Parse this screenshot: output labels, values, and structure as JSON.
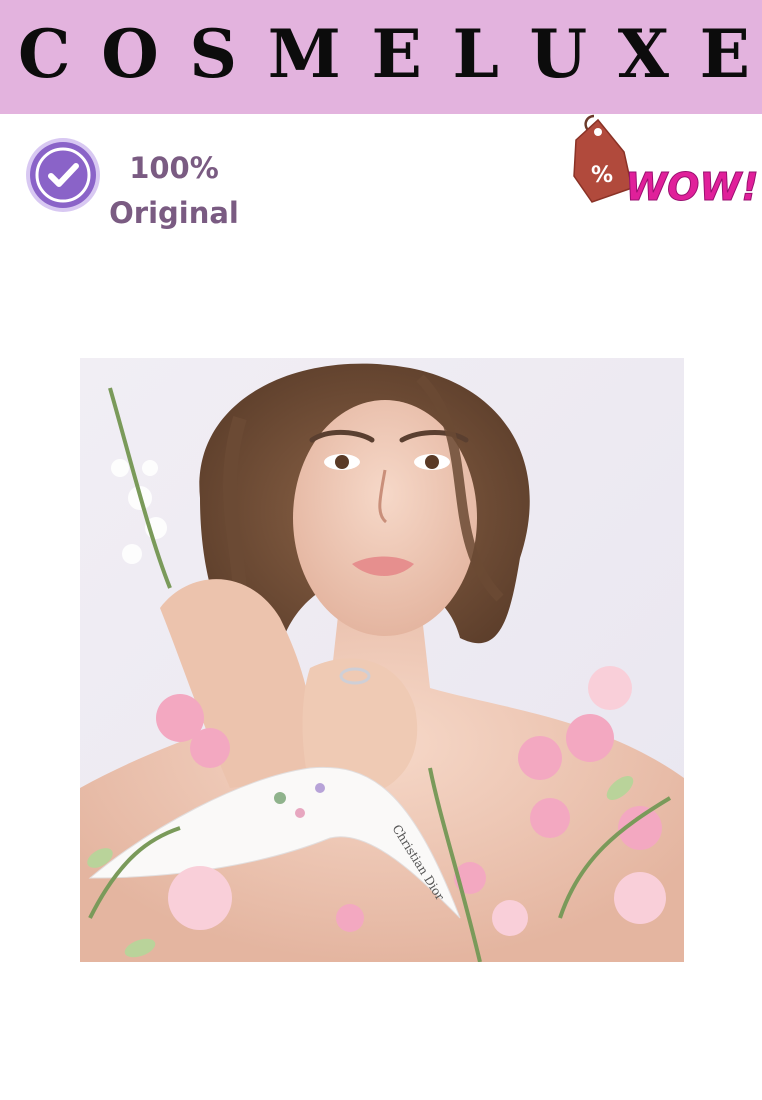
{
  "brand": {
    "letters": [
      "C",
      "O",
      "S",
      "M",
      "E",
      "L",
      "U",
      "X",
      "E"
    ],
    "bar_color": "#e3b3de"
  },
  "authenticity_badge": {
    "percent": "100%",
    "label": "Original",
    "icon": "check-circle-icon",
    "color": "#7a5b82"
  },
  "promo_badge": {
    "tag_symbol": "%",
    "text": "WOW!",
    "icon": "price-tag-icon",
    "accent": "#e0209a"
  },
  "hero_image": {
    "subject": "model-with-flowers-photo",
    "scarf_text": "Christian Dior"
  }
}
